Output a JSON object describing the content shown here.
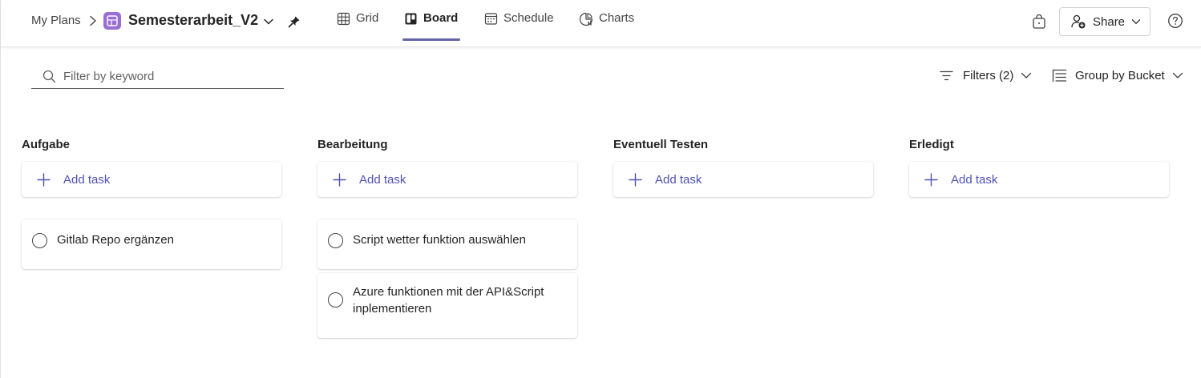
{
  "header": {
    "breadcrumb_root": "My Plans",
    "plan_title": "Semesterarbeit_V2",
    "tabs": [
      {
        "label": "Grid",
        "icon": "grid-icon",
        "active": false
      },
      {
        "label": "Board",
        "icon": "board-icon",
        "active": true
      },
      {
        "label": "Schedule",
        "icon": "calendar-icon",
        "active": false
      },
      {
        "label": "Charts",
        "icon": "chart-icon",
        "active": false
      }
    ],
    "share_label": "Share",
    "accent_color": "#6264a7",
    "plan_icon_color": "#9b6ed6"
  },
  "toolbar": {
    "filter_placeholder": "Filter by keyword",
    "filters_label": "Filters (2)",
    "groupby_label": "Group by Bucket"
  },
  "board": {
    "add_task_label": "Add task",
    "buckets": [
      {
        "name": "Aufgabe",
        "tasks": [
          "Gitlab Repo ergänzen"
        ]
      },
      {
        "name": "Bearbeitung",
        "tasks": [
          "Script wetter funktion auswählen",
          "Azure funktionen mit der API&Script inplementieren"
        ]
      },
      {
        "name": "Eventuell Testen",
        "tasks": []
      },
      {
        "name": "Erledigt",
        "tasks": []
      }
    ]
  }
}
